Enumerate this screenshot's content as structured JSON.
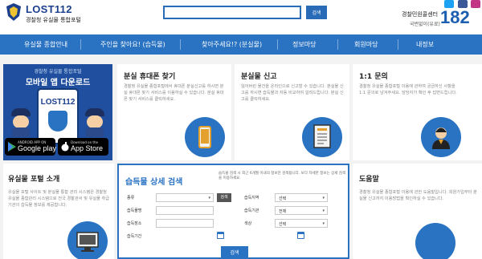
{
  "header": {
    "logo_brand": "LOST112",
    "logo_sub": "경찰청 유실물 통합포털",
    "search": {
      "value": "",
      "button_label": "검색"
    },
    "callcenter": {
      "label": "경찰민원콜센터",
      "number": "182",
      "sub": "국번없이(유료)"
    },
    "social": [
      {
        "icon": "twitter-icon",
        "color": "#1da1f2"
      },
      {
        "icon": "facebook-icon",
        "color": "#3b5998"
      },
      {
        "icon": "instagram-icon",
        "color": "#c13584"
      }
    ]
  },
  "nav": {
    "items": [
      {
        "label": "유실물 종합안내",
        "name": "nav-guide"
      },
      {
        "label": "주인을 찾아요! (습득물)",
        "name": "nav-found"
      },
      {
        "label": "찾아주세요!? (분실물)",
        "name": "nav-lost"
      },
      {
        "label": "정보마당",
        "name": "nav-info"
      },
      {
        "label": "회원마당",
        "name": "nav-member"
      },
      {
        "label": "내정보",
        "name": "nav-myinfo"
      }
    ]
  },
  "app_banner": {
    "sub": "경찰청 유실물 통합포털",
    "title": "모바일 앱 다운로드",
    "phone_logo": "LOST112",
    "google_small": "ANDROID APP ON",
    "google_big": "Google play",
    "apple_small": "Download on the",
    "apple_big": "App Store"
  },
  "cards": [
    {
      "name": "card-phone",
      "title": "분실 휴대폰 찾기",
      "desc": "경찰청 유실물 종합포털에서 휴대폰 분실신고를 하시면 분실 휴대폰 찾기 서비스를 이용하실 수 있습니다. 분실 휴대폰 찾기 서비스를 클릭하세요.",
      "icon": "mobile-phone-icon"
    },
    {
      "name": "card-report",
      "title": "분실물 신고",
      "desc": "잃어버린 물건을 온라인으로 신고할 수 있습니다. 분실물 신고를 하시면 습득물과 자동 비교하여 알려드립니다. 분실 신고를 클릭하세요.",
      "icon": "document-icon"
    },
    {
      "name": "card-inquiry",
      "title": "1:1 문의",
      "desc": "경찰청 유실물 종합포털 이용에 관하여 궁금하신 사항을 1:1 문의로 남겨주세요. 담당자가 확인 후 답변드립니다.",
      "icon": "support-agent-icon"
    }
  ],
  "portal": {
    "title": "유실물 포털 소개",
    "desc": "유실물 포털 사이트 및 분실물 통합 관리 시스템은 경찰청 유실물 종합관리 시스템으로 전국 경찰관서 및 유실물 취급기관의 습득물 정보를 제공합니다.",
    "icon": "monitor-icon"
  },
  "found_search": {
    "title": "습득물 상세 검색",
    "note": "습득물 검색 시 최근 6개월 이내의 정보만 검색됩니다. 보다 자세한 정보는 상세 검색을 이용하세요.",
    "fields": {
      "category_label": "종류",
      "category_button": "검색",
      "item_name_label": "습득물명",
      "place_label": "습득장소",
      "period_label": "습득기간",
      "region_label": "습득지역",
      "region_value": "선택",
      "agency_label": "습득기관",
      "agency_value": "전체",
      "color_label": "색상",
      "color_value": "선택"
    },
    "submit_label": "검색"
  },
  "help": {
    "title": "도움말",
    "desc": "경찰청 유실물 종합포털 이용에 관한 도움말입니다. 회원가입부터 분실물 신고까지 이용방법을 확인하실 수 있습니다."
  },
  "colors": {
    "primary": "#2a73c3",
    "dark_blue": "#1c3f8c",
    "background": "#f3f3f3"
  }
}
